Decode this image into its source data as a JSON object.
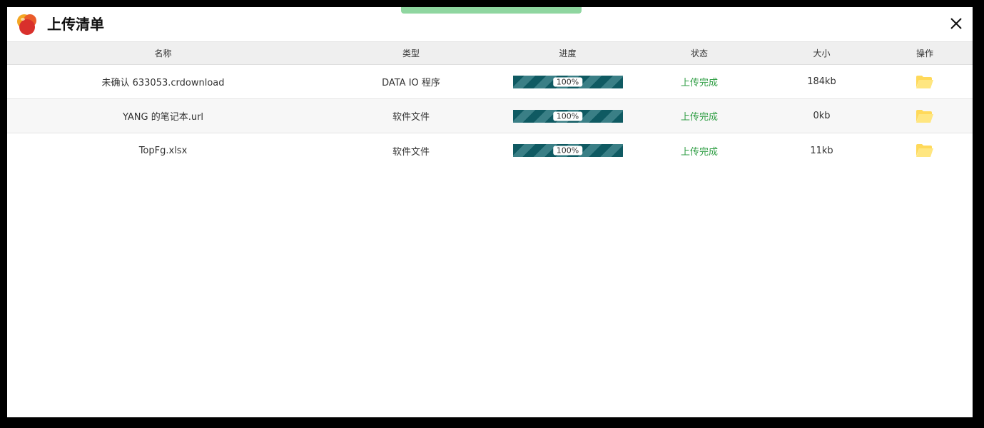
{
  "window": {
    "title": "上传清单"
  },
  "table": {
    "headers": {
      "name": "名称",
      "type": "类型",
      "progress": "进度",
      "status": "状态",
      "size": "大小",
      "action": "操作"
    },
    "rows": [
      {
        "name": "未确认 633053.crdownload",
        "type": "DATA IO 程序",
        "progress_label": "100%",
        "progress_value": 100,
        "status": "上传完成",
        "size": "184kb"
      },
      {
        "name": "YANG 的笔记本.url",
        "type": "软件文件",
        "progress_label": "100%",
        "progress_value": 100,
        "status": "上传完成",
        "size": "0kb"
      },
      {
        "name": "TopFg.xlsx",
        "type": "软件文件",
        "progress_label": "100%",
        "progress_value": 100,
        "status": "上传完成",
        "size": "11kb"
      }
    ]
  },
  "icons": {
    "logo": "app-logo-icon",
    "close": "close-icon",
    "action": "folder-open-icon"
  },
  "colors": {
    "status_complete": "#2f9e44",
    "progress_dark": "#0f5a62",
    "progress_light": "#3a7f86",
    "folder": "#ffe27a",
    "toast": "#8fd6a0"
  }
}
